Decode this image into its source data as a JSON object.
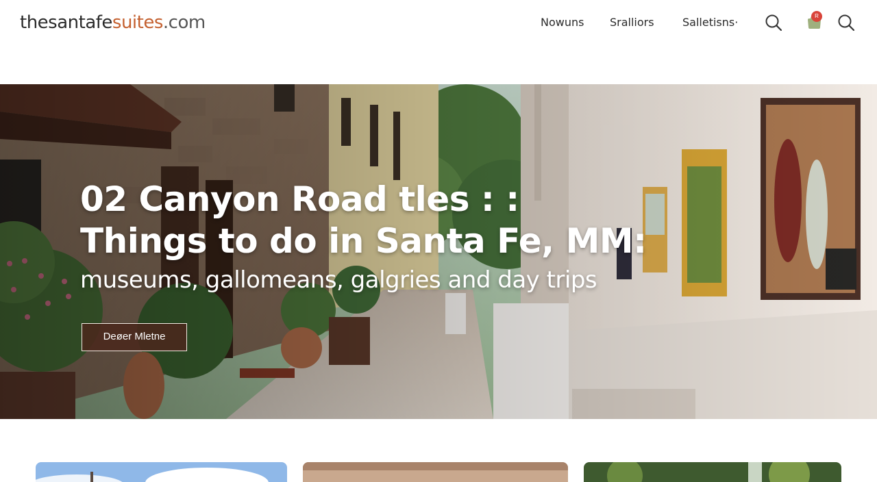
{
  "header": {
    "logo": {
      "part1": "thesantafe",
      "part2": "suites",
      "part3": ".com"
    },
    "nav": [
      {
        "label": "Nowuns"
      },
      {
        "label": "Sralliors"
      },
      {
        "label": "Salletisns·"
      }
    ],
    "icons": [
      "search-icon",
      "cart-icon",
      "search-icon"
    ],
    "cart_badge": "R"
  },
  "hero": {
    "title_line1": "02 Canyon Road tles : :",
    "title_line2": "Things to do in Santa Fe, MM:",
    "subtitle": "museums, gallomeans, galgries and day trips",
    "button_label": "Deøer Mletne"
  },
  "colors": {
    "brand_dark": "#2b2b2b",
    "brand_accent": "#c4602f",
    "button_bg": "#4a281c",
    "badge": "#d9443a"
  }
}
